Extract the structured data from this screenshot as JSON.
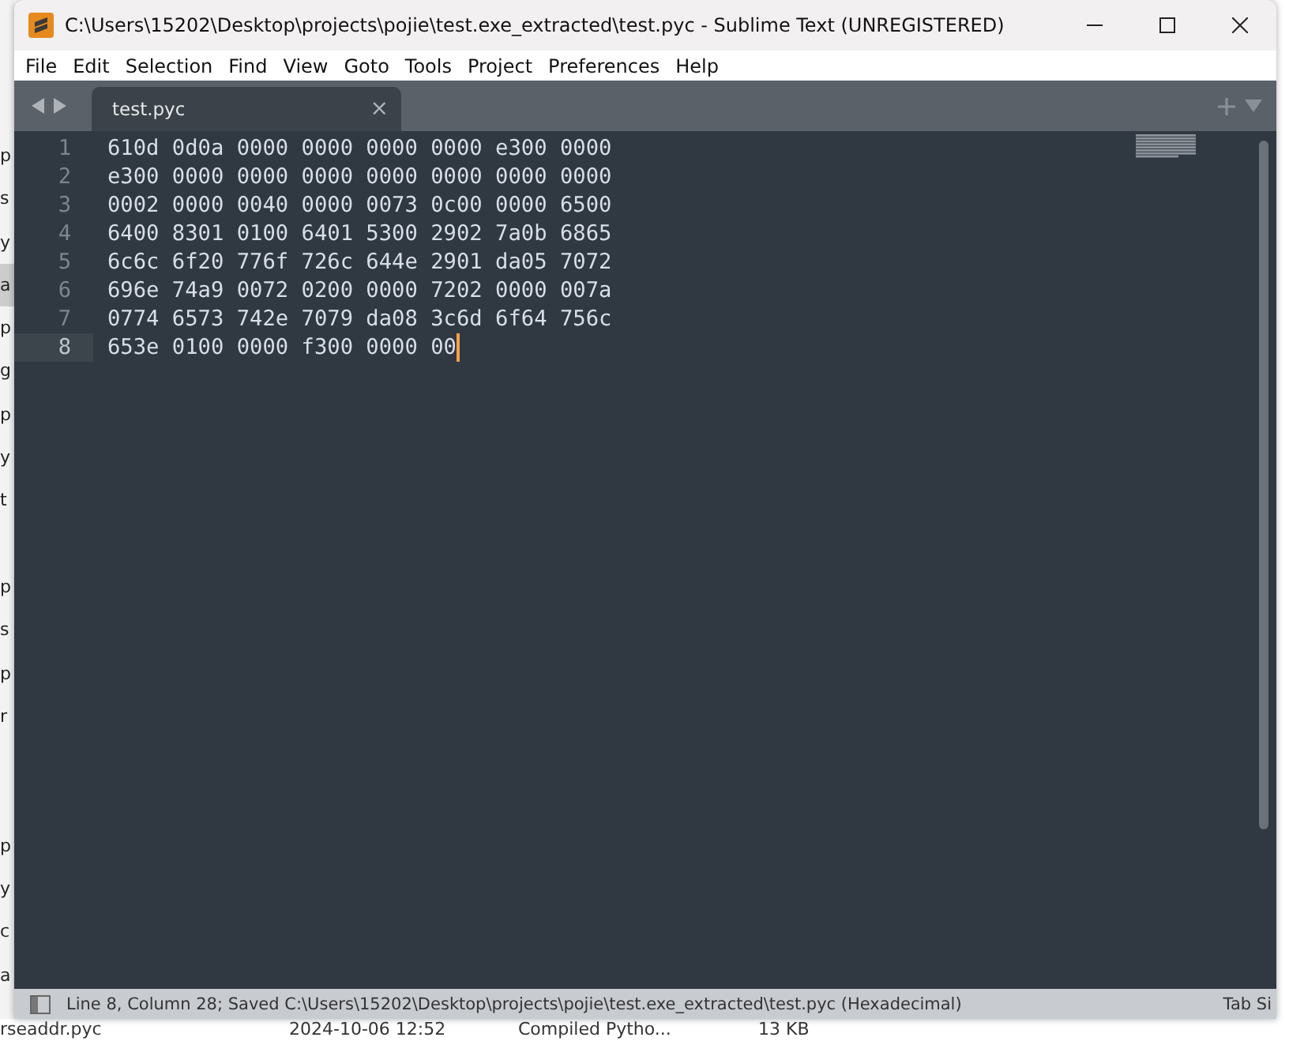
{
  "window": {
    "title": "C:\\Users\\15202\\Desktop\\projects\\pojie\\test.exe_extracted\\test.pyc - Sublime Text (UNREGISTERED)"
  },
  "menu": [
    "File",
    "Edit",
    "Selection",
    "Find",
    "View",
    "Goto",
    "Tools",
    "Project",
    "Preferences",
    "Help"
  ],
  "tabs": [
    {
      "label": "test.pyc",
      "selected": true,
      "close": "×"
    }
  ],
  "lines": [
    {
      "number": "1",
      "text": "610d 0d0a 0000 0000 0000 0000 e300 0000",
      "current": false
    },
    {
      "number": "2",
      "text": "e300 0000 0000 0000 0000 0000 0000 0000",
      "current": false
    },
    {
      "number": "3",
      "text": "0002 0000 0040 0000 0073 0c00 0000 6500",
      "current": false
    },
    {
      "number": "4",
      "text": "6400 8301 0100 6401 5300 2902 7a0b 6865",
      "current": false
    },
    {
      "number": "5",
      "text": "6c6c 6f20 776f 726c 644e 2901 da05 7072",
      "current": false
    },
    {
      "number": "6",
      "text": "696e 74a9 0072 0200 0000 7202 0000 007a",
      "current": false
    },
    {
      "number": "7",
      "text": "0774 6573 742e 7079 da08 3c6d 6f64 756c",
      "current": false
    },
    {
      "number": "8",
      "text": "653e 0100 0000 f300 0000 00",
      "current": true
    }
  ],
  "status_bar": {
    "text": "Line 8, Column 28; Saved C:\\Users\\15202\\Desktop\\projects\\pojie\\test.exe_extracted\\test.pyc (Hexadecimal)",
    "right": "Tab Si"
  },
  "background": {
    "side_fragments": [
      {
        "text": "p",
        "selected": false
      },
      {
        "text": "s",
        "selected": false
      },
      {
        "text": "y",
        "selected": false
      },
      {
        "text": "a",
        "selected": true
      },
      {
        "text": "p",
        "selected": false
      },
      {
        "text": "g",
        "selected": false
      },
      {
        "text": "p",
        "selected": false
      },
      {
        "text": "y",
        "selected": false
      },
      {
        "text": "t",
        "selected": false
      },
      {
        "selected": false
      },
      {
        "text": "p",
        "selected": false
      },
      {
        "text": "s",
        "selected": false
      },
      {
        "text": "p",
        "selected": false
      },
      {
        "text": "r",
        "selected": false
      },
      {
        "selected": false
      },
      {
        "selected": false
      },
      {
        "text": "p",
        "selected": false
      },
      {
        "text": "y",
        "selected": false
      },
      {
        "text": "c",
        "selected": false
      },
      {
        "text": "a",
        "selected": false
      }
    ],
    "file_row": {
      "name": "rseaddr.pyc",
      "date": "2024-10-06 12:52",
      "type": "Compiled Pytho...",
      "size": "13 KB"
    }
  }
}
